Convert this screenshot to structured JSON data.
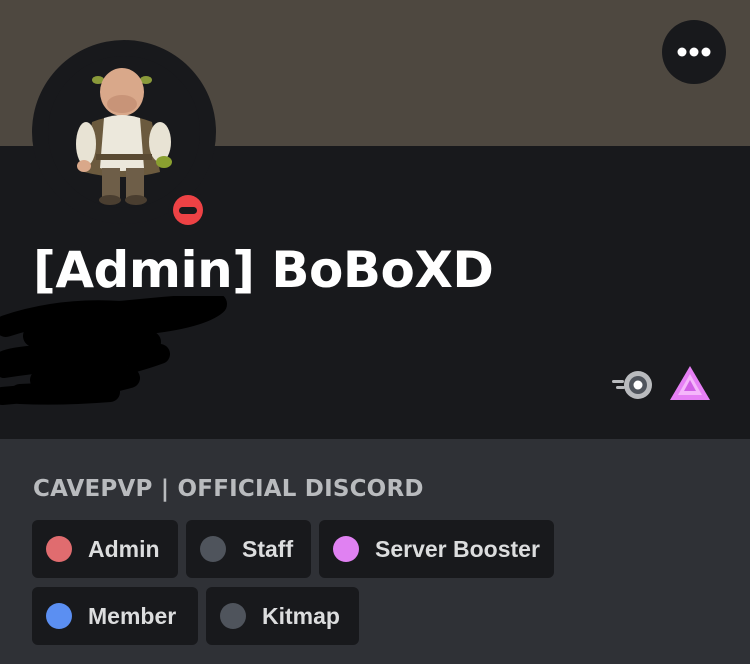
{
  "profile": {
    "display_name": "[Admin] BoBoXD",
    "status": "do-not-disturb",
    "status_color": "#ed4245",
    "banner_color": "#4e4840",
    "badges": [
      "nitro-icon",
      "server-boost-icon"
    ]
  },
  "header": {
    "more_icon": "ellipsis-icon"
  },
  "server": {
    "name": "CAVEPVP | OFFICIAL DISCORD"
  },
  "roles": [
    {
      "label": "Admin",
      "color": "#e06c6f"
    },
    {
      "label": "Staff",
      "color": "#4f545c"
    },
    {
      "label": "Server Booster",
      "color": "#e081f2"
    },
    {
      "label": "Member",
      "color": "#5b8ff2"
    },
    {
      "label": "Kitmap",
      "color": "#4f545c"
    }
  ]
}
